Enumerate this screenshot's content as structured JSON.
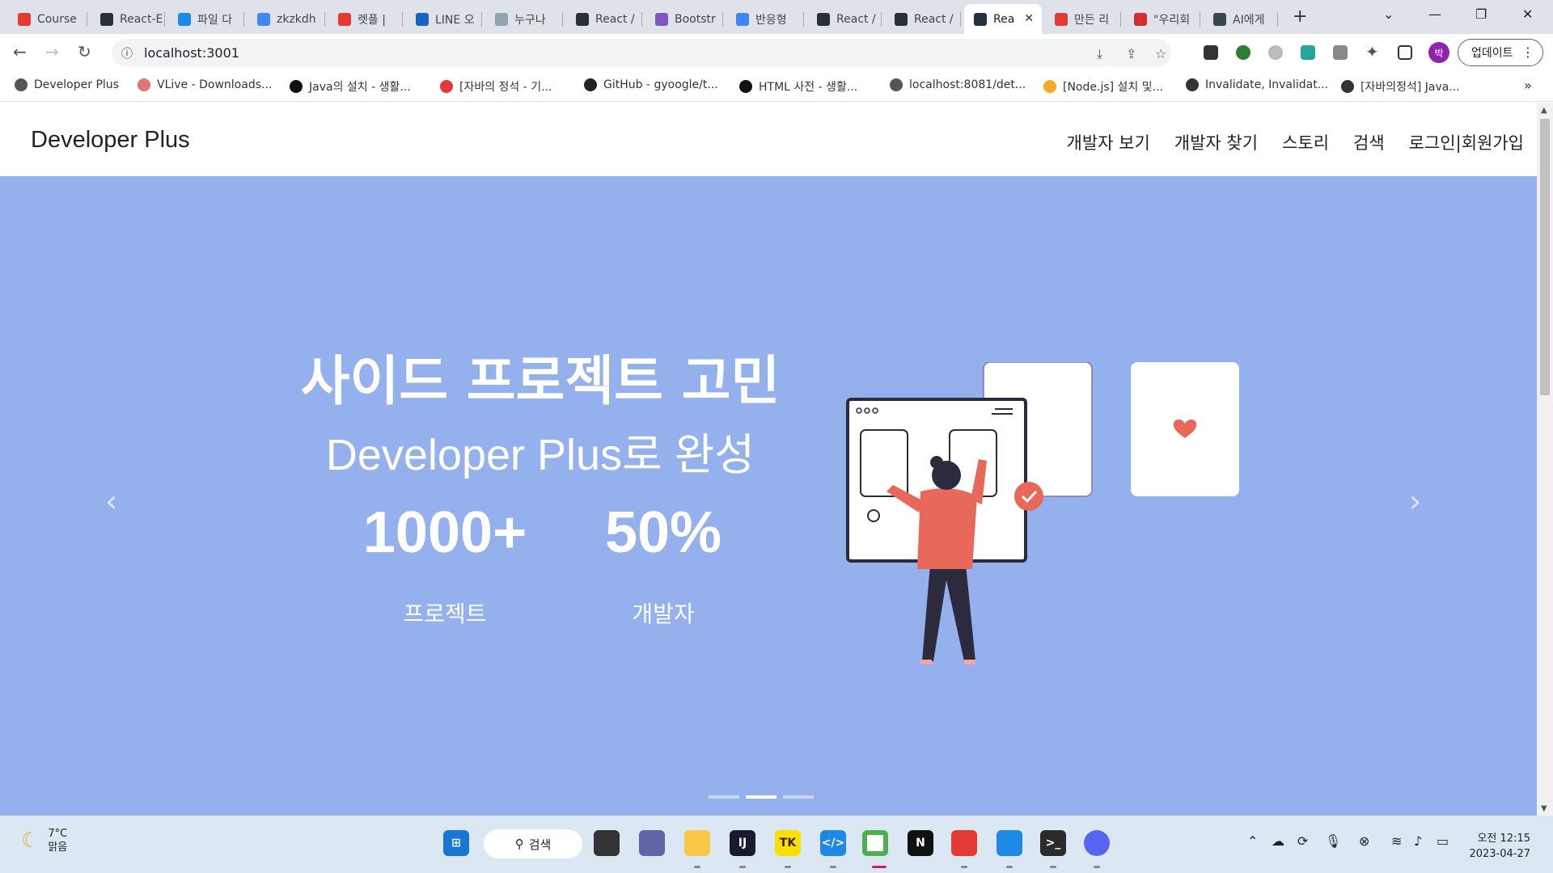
{
  "browser": {
    "tabs": [
      {
        "label": "Course",
        "color": "#e53935"
      },
      {
        "label": "React-E",
        "color": "#263238"
      },
      {
        "label": "파일 다",
        "color": "#1e88e5"
      },
      {
        "label": "zkzkdh",
        "color": "#4285f4"
      },
      {
        "label": "렛플 |",
        "color": "#e53935"
      },
      {
        "label": "LINE 오",
        "color": "#1565c0"
      },
      {
        "label": "누구나",
        "color": "#90a4ae"
      },
      {
        "label": "React /",
        "color": "#263238"
      },
      {
        "label": "Bootstr",
        "color": "#7e57c2"
      },
      {
        "label": "반응형",
        "color": "#4285f4"
      },
      {
        "label": "React /",
        "color": "#263238"
      },
      {
        "label": "React /",
        "color": "#263238"
      },
      {
        "label": "Rea",
        "color": "#263238"
      },
      {
        "label": "만든 리",
        "color": "#e53935"
      },
      {
        "label": "\"우리회",
        "color": "#d32f2f"
      },
      {
        "label": "AI에게",
        "color": "#37474f"
      }
    ],
    "active_tab_index": 12,
    "url": "localhost:3001",
    "update_label": "업데이트",
    "profile_initial": "박",
    "bookmarks": [
      {
        "label": "Developer Plus",
        "color": "#555"
      },
      {
        "label": "VLive - Downloads...",
        "color": "#e57373"
      },
      {
        "label": "Java의 설치 - 생활...",
        "color": "#111"
      },
      {
        "label": "[자바의 정석 - 기...",
        "color": "#e53935"
      },
      {
        "label": "GitHub - gyoogle/t...",
        "color": "#222"
      },
      {
        "label": "HTML 사전 - 생활...",
        "color": "#111"
      },
      {
        "label": "localhost:8081/det...",
        "color": "#555"
      },
      {
        "label": "[Node.js] 설치 및...",
        "color": "#f9a825"
      },
      {
        "label": "Invalidate, Invalidat...",
        "color": "#333"
      },
      {
        "label": "[자바의정석] Java...",
        "color": "#333"
      }
    ]
  },
  "site": {
    "brand": "Developer Plus",
    "nav": [
      "개발자 보기",
      "개발자 찾기",
      "스토리",
      "검색",
      "로그인|회원가입"
    ],
    "hero": {
      "title": "사이드 프로젝트 고민",
      "subtitle": "Developer Plus로 완성",
      "stats": [
        {
          "value": "1000+",
          "label": "프로젝트"
        },
        {
          "value": "50%",
          "label": "개발자"
        }
      ],
      "slide_count": 3,
      "active_slide": 1
    },
    "colors": {
      "hero_bg": "#94b0ed",
      "accent": "#e8695a"
    }
  },
  "taskbar": {
    "temperature": "7°C",
    "weather": "맑음",
    "search_label": "검색",
    "time": "오전 12:15",
    "date": "2023-04-27"
  }
}
